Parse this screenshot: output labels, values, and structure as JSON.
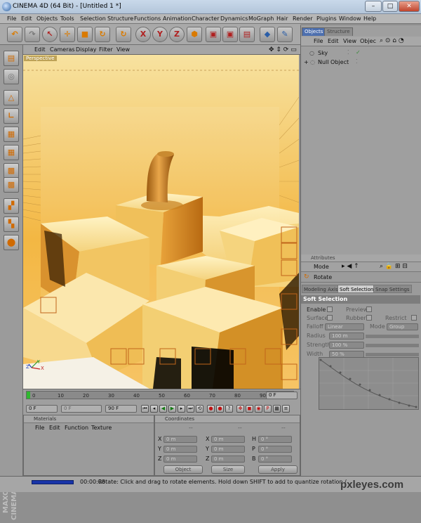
{
  "window": {
    "title": "CINEMA 4D (64 Bit) - [Untitled 1 *]",
    "btn_min": "–",
    "btn_max": "□",
    "btn_close": "✕"
  },
  "menu": [
    "File",
    "Edit",
    "Objects",
    "Tools",
    "Selection",
    "Structure",
    "Functions",
    "Animation",
    "Character",
    "Dynamics",
    "MoGraph",
    "Hair",
    "Render",
    "Plugins",
    "Window",
    "Help"
  ],
  "toolbar": {
    "x": "X",
    "y": "Y",
    "z": "Z"
  },
  "viewport": {
    "menu": [
      "Edit",
      "Cameras",
      "Display",
      "Filter",
      "View"
    ],
    "label": "Perspective",
    "axis_y": "Y",
    "axis_z": "Z",
    "axis_x": "X"
  },
  "timeline": {
    "ticks": [
      "0",
      "10",
      "20",
      "30",
      "40",
      "50",
      "60",
      "70",
      "80",
      "90"
    ],
    "current_frame": "0 F",
    "start": "0 F",
    "offset": "0 F",
    "end": "90 F",
    "value": 0.0
  },
  "materials": {
    "title": "Materials",
    "menu": [
      "File",
      "Edit",
      "Function",
      "Texture"
    ]
  },
  "coordinates": {
    "title": "Coordinates",
    "col_dash_1": "--",
    "col_dash_2": "--",
    "col_dash_3": "--",
    "rows": [
      {
        "a": "X",
        "b": "X",
        "c": "H",
        "v1": "0 m",
        "v2": "0 m",
        "v3": "0 °"
      },
      {
        "a": "Y",
        "b": "Y",
        "c": "P",
        "v1": "0 m",
        "v2": "0 m",
        "v3": "0 °"
      },
      {
        "a": "Z",
        "b": "Z",
        "c": "B",
        "v1": "0 m",
        "v2": "0 m",
        "v3": "0 °"
      }
    ],
    "object_select": "Object",
    "size_select": "Size",
    "apply": "Apply"
  },
  "objects": {
    "tabs": [
      "Objects",
      "Structure"
    ],
    "menu": [
      "File",
      "Edit",
      "View",
      "Objec"
    ],
    "items": [
      "Sky",
      "Null Object"
    ]
  },
  "attributes": {
    "title": "Attributes",
    "mode": "Mode",
    "tool": "Rotate",
    "tabs": [
      "Modeling Axis",
      "Soft Selection",
      "Snap Settings"
    ],
    "section": "Soft Selection",
    "enable": "Enable",
    "preview": "Preview",
    "surface": "Surface",
    "rubber": "Rubber",
    "restrict": "Restrict",
    "falloff": "Falloff",
    "falloff_value": "Linear",
    "mode_label": "Mode",
    "mode_value": "Group",
    "radius": "Radius",
    "radius_value": "100 m",
    "strength": "Strength",
    "strength_value": "100 %",
    "width": "Width",
    "width_value": "50 %"
  },
  "status": {
    "time": "00:00:08",
    "message": "Rotate: Click and drag to rotate elements. Hold down SHIFT to add to quantize rotation /"
  },
  "watermark": "pxleyes.com",
  "brand": "MAXON CINEMA 4D",
  "colors": {
    "accent_orange": "#d97a00",
    "progress_blue": "#1834a8"
  }
}
